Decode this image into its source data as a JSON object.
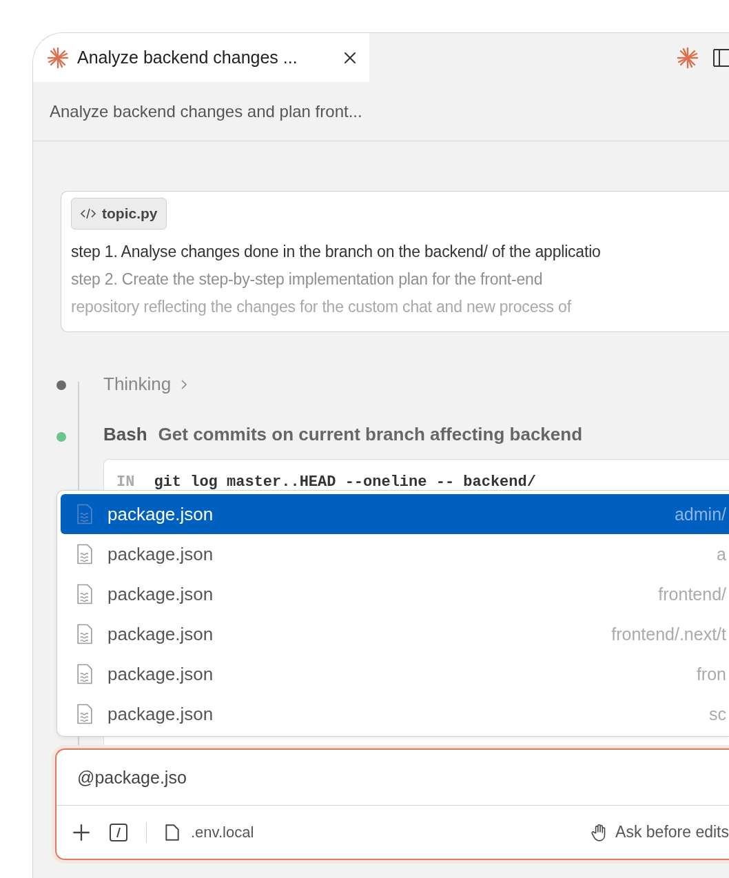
{
  "tab": {
    "title": "Analyze backend changes ...",
    "selected": true
  },
  "header": {
    "title": "Analyze backend changes and plan front..."
  },
  "message": {
    "attachment": "topic.py",
    "lines": [
      "step 1. Analyse changes done in the branch on the backend/ of the applicatio",
      "step 2. Create the step-by-step implementation plan for the front-end",
      "repository reflecting the changes for the custom chat and new process of"
    ]
  },
  "timeline": [
    {
      "kind": "thinking",
      "label": "Thinking",
      "color": "#6b6b6b"
    },
    {
      "kind": "tool",
      "tool": "Bash",
      "description": "Get commits on current branch affecting backend",
      "color": "#6cc48a",
      "code_label": "IN",
      "code": "git log master..HEAD --oneline -- backend/"
    }
  ],
  "suggestions": [
    {
      "name": "package.json",
      "path": "admin/",
      "selected": true
    },
    {
      "name": "package.json",
      "path": "a",
      "selected": false
    },
    {
      "name": "package.json",
      "path": "frontend/",
      "selected": false
    },
    {
      "name": "package.json",
      "path": "frontend/.next/t",
      "selected": false
    },
    {
      "name": "package.json",
      "path": "fron",
      "selected": false
    },
    {
      "name": "package.json",
      "path": "sc",
      "selected": false
    }
  ],
  "composer": {
    "value": "@package.jso",
    "context_file": ".env.local",
    "mode": "Ask before edits"
  }
}
